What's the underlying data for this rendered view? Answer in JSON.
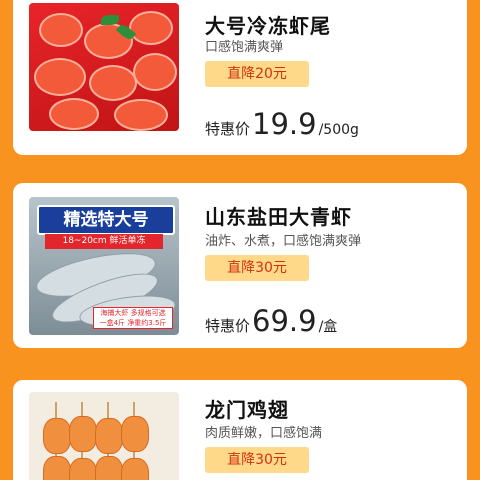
{
  "products": [
    {
      "title": "大号冷冻虾尾",
      "description": "口感饱满爽弹",
      "discount": "直降20元",
      "price_label": "特惠价",
      "price": "19.9",
      "unit": "/500g",
      "image": "red-shrimp-tails-photo"
    },
    {
      "title": "山东盐田大青虾",
      "description": "油炸、水煮，口感饱满爽弹",
      "discount": "直降30元",
      "price_label": "特惠价",
      "price": "69.9",
      "unit": "/盒",
      "image": "green-prawns-photo",
      "image_banner": "精选特大号",
      "image_subbanner": "18~20cm 鲜活单冻",
      "image_note_1": "海捕大虾 多规格可选",
      "image_note_2": "一盒4斤 净重约3.5斤"
    },
    {
      "title": "龙门鸡翅",
      "description": "肉质鲜嫩，口感饱满",
      "discount": "直降30元",
      "image": "chicken-wing-skewers-photo"
    }
  ],
  "colors": {
    "background": "#f7931e",
    "badge_bg": "#ffd98a",
    "badge_text": "#d0320f"
  }
}
